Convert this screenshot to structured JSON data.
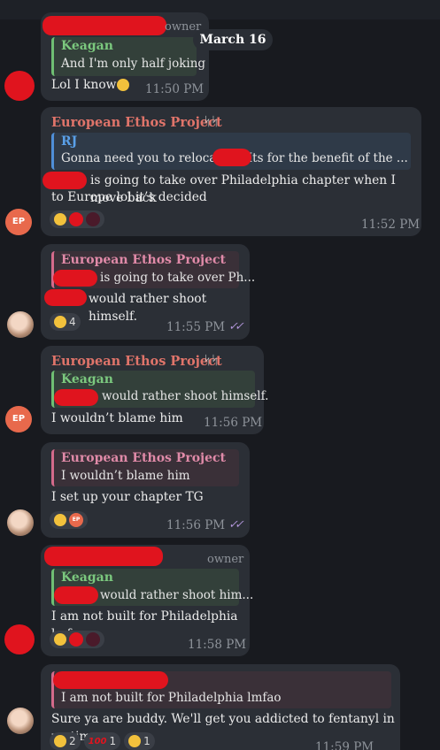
{
  "date_separator": "March 16",
  "messages": [
    {
      "owner_label": "owner",
      "quote_name": "Keagan",
      "quote_text": "And I'm only half joking",
      "text": "Lol I know",
      "emoji": "😁",
      "time": "11:50 PM"
    },
    {
      "sender": "European Ethos Project",
      "sender_icon": "ᛋᛋ",
      "quote_name": "RJ",
      "quote_text": "Gonna need you to relocate … Its for the benefit of the ...",
      "text_line1": "is going to take over Philadelphia chapter when I move back",
      "text_line2": "to Europe lol it’s decided",
      "time": "11:52 PM",
      "avatar": "EP"
    },
    {
      "quote_name": "European Ethos Project",
      "quote_text": "is going to take over Ph...",
      "text": "would rather shoot himself.",
      "reaction_count": "4",
      "time": "11:55 PM"
    },
    {
      "sender": "European Ethos Project",
      "sender_icon": "ᛋᛋ",
      "quote_name": "Keagan",
      "quote_text": "would rather shoot himself.",
      "text": "I wouldn’t blame him",
      "time": "11:56 PM",
      "avatar": "EP"
    },
    {
      "quote_name": "European Ethos Project",
      "quote_text": "I wouldn’t blame him",
      "text": "I set up your chapter TG",
      "time": "11:56 PM",
      "reaction_avatar": "EP"
    },
    {
      "owner_label": "owner",
      "quote_name": "Keagan",
      "quote_text": "would rather shoot him...",
      "text": "I am not built for Philadelphia lmfao",
      "time": "11:58 PM"
    },
    {
      "quote_text": "I am not built for Philadelphia lmfao",
      "text": "Sure ya are buddy. We'll get you addicted to fentanyl in no time.",
      "reactions": [
        {
          "emoji": "🤣",
          "count": "2"
        },
        {
          "emoji": "💯",
          "count": "1"
        },
        {
          "emoji": "😭",
          "count": "1"
        }
      ],
      "time": "11:59 PM"
    }
  ],
  "colors": {
    "background": "#181a1f",
    "bubble": "#2b2f36",
    "sender_ethos": "#e0746a",
    "quote_green": "#7bc87e",
    "quote_pink": "#e08aa8",
    "quote_blue": "#5aa0e8",
    "redaction": "#e0141e",
    "read_ticks": "#b094d8"
  }
}
